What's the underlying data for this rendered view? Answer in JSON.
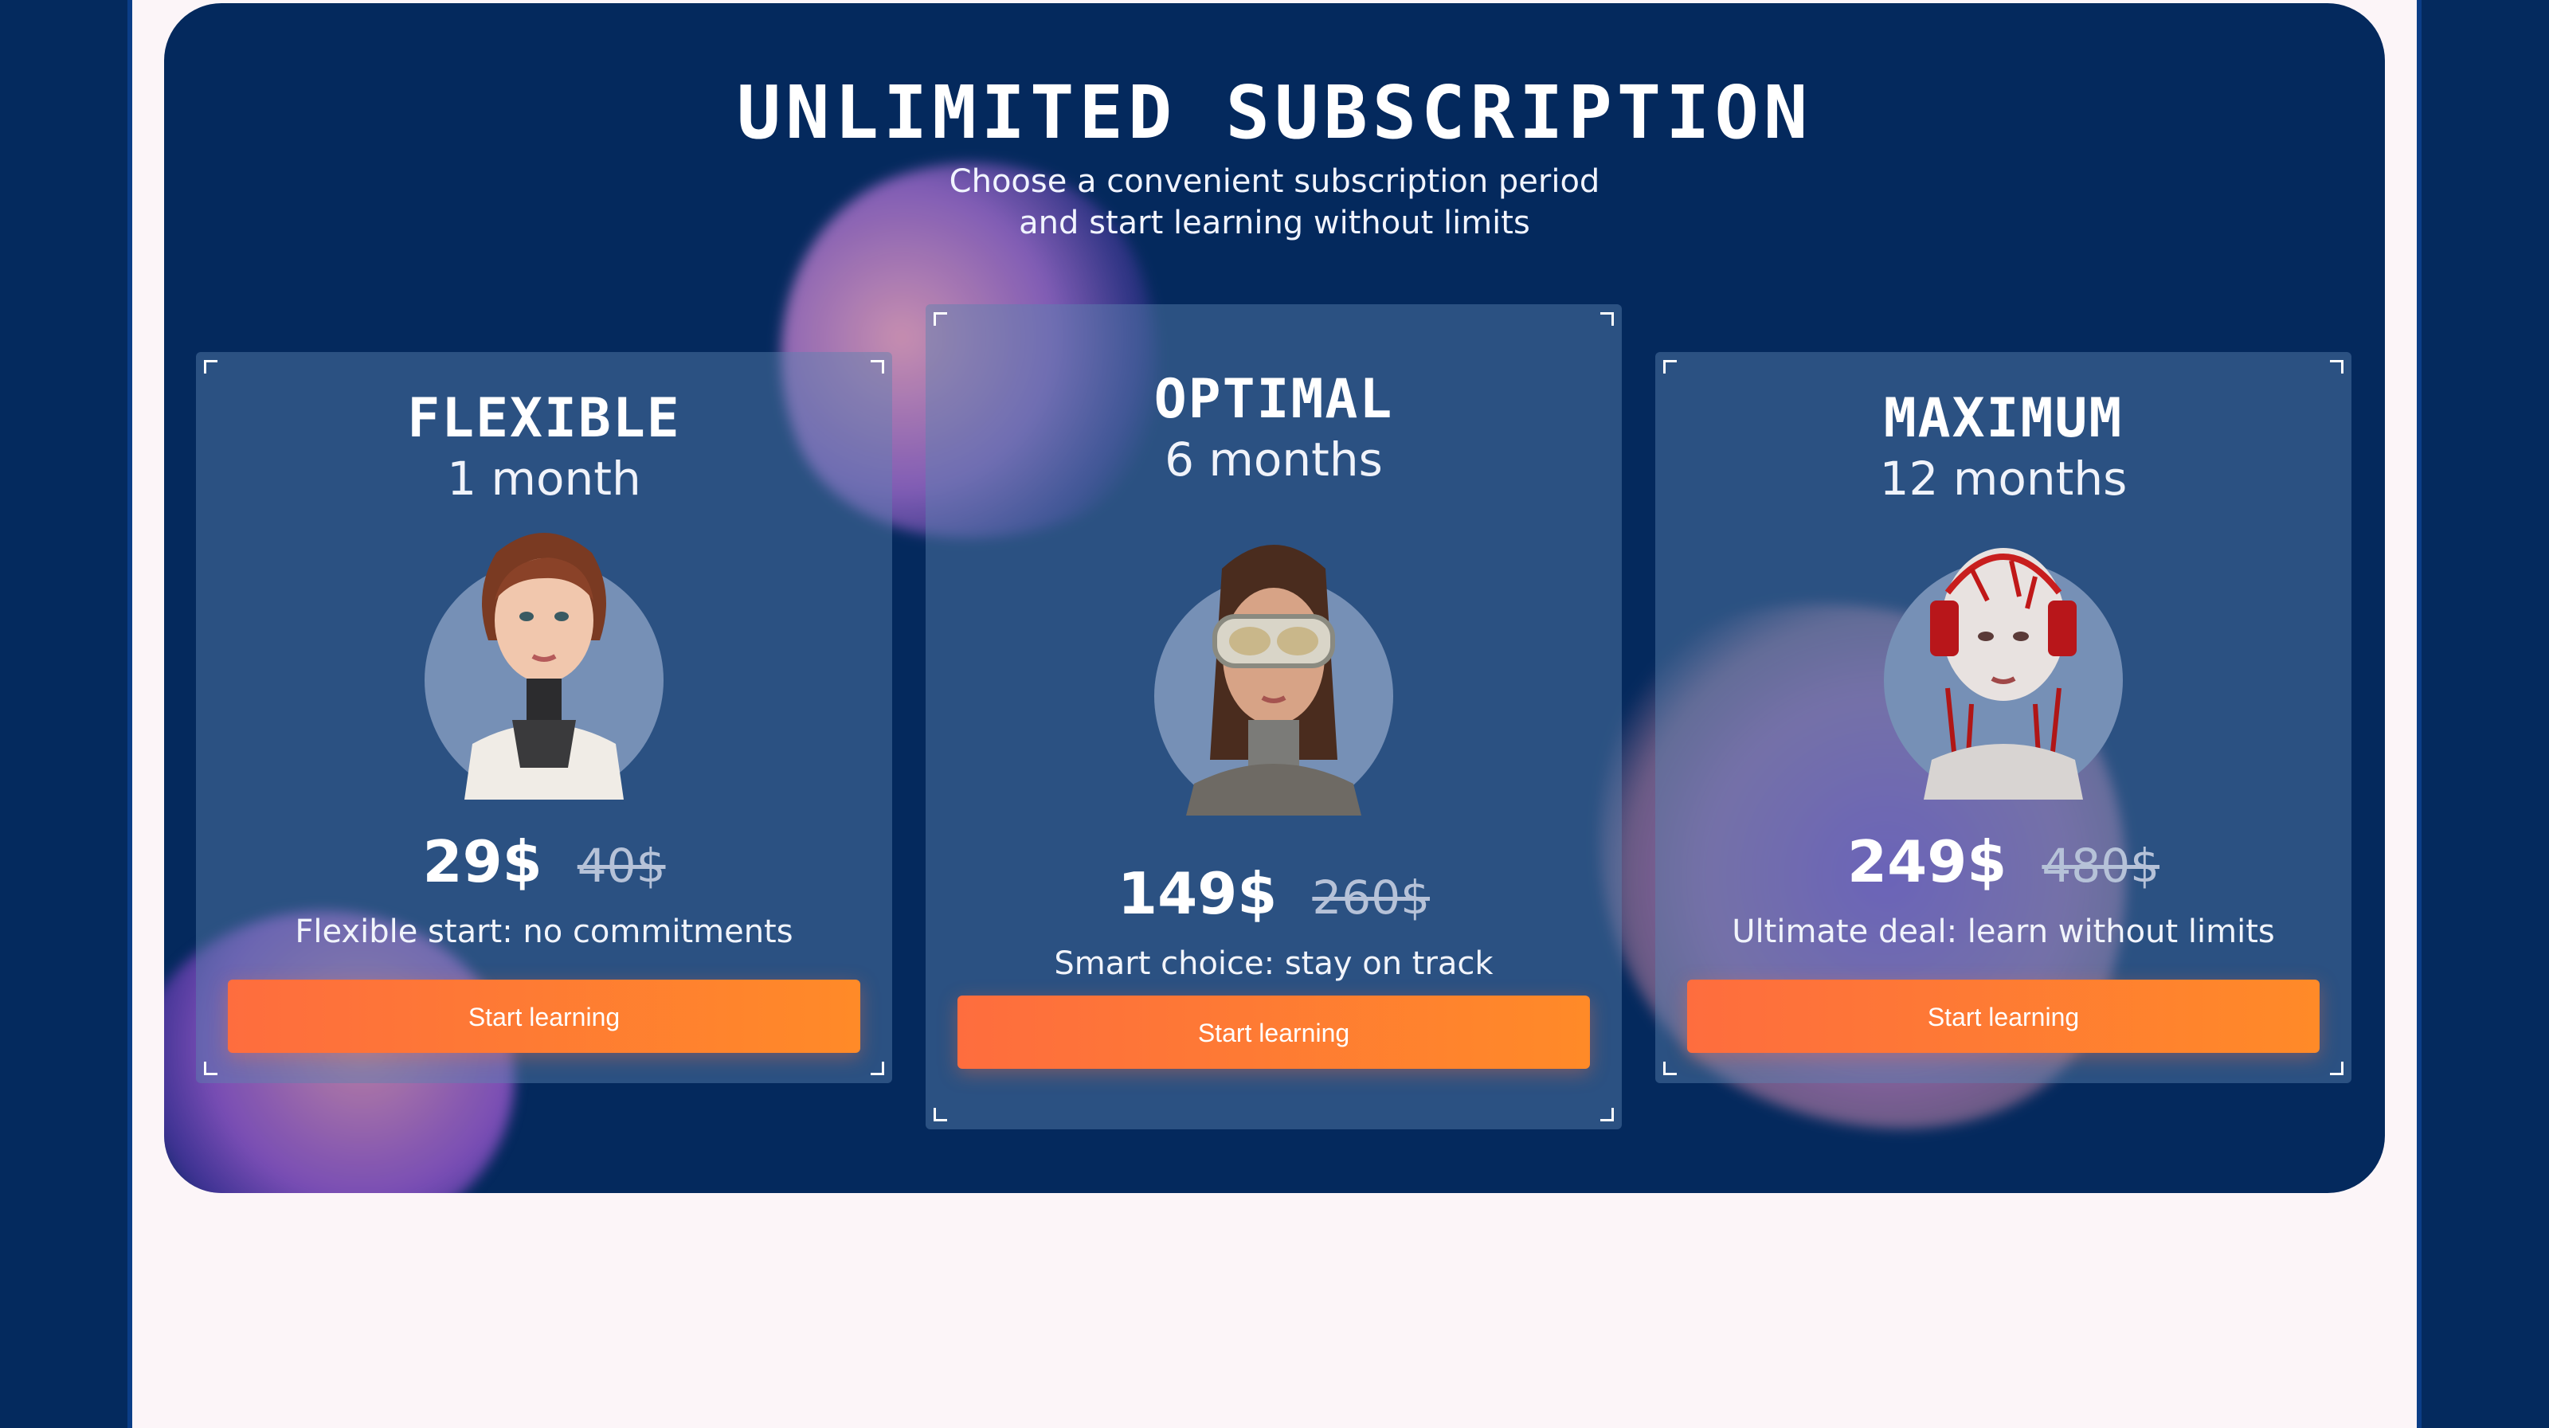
{
  "section": {
    "title": "UNLIMITED SUBSCRIPTION",
    "subtitle_line1": "Choose a convenient subscription period",
    "subtitle_line2": "and start learning without limits"
  },
  "plans": [
    {
      "name": "FLEXIBLE",
      "period": "1 month",
      "price": "29$",
      "old_price": "40$",
      "tagline": "Flexible start: no commitments",
      "cta": "Start learning",
      "avatar": "robot-woman-avatar"
    },
    {
      "name": "OPTIMAL",
      "period": "6 months",
      "price": "149$",
      "old_price": "260$",
      "tagline": "Smart choice: stay on track",
      "cta": "Start learning",
      "avatar": "goggles-woman-avatar"
    },
    {
      "name": "MAXIMUM",
      "period": "12 months",
      "price": "249$",
      "old_price": "480$",
      "tagline": "Ultimate deal: learn without limits",
      "cta": "Start learning",
      "avatar": "red-cyborg-avatar"
    }
  ],
  "colors": {
    "background": "#04295d",
    "page": "#fcf5f8",
    "accent": "#fe6d3e",
    "card": "#5c82af"
  }
}
